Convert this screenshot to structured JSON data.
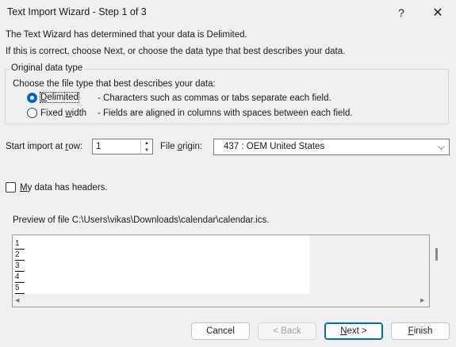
{
  "window": {
    "title": "Text Import Wizard - Step 1 of 3",
    "help_icon": "question-mark-icon",
    "close_icon": "close-icon"
  },
  "intro": {
    "line1": "The Text Wizard has determined that your data is Delimited.",
    "line2": "If this is correct, choose Next, or choose the data type that best describes your data."
  },
  "original_data_type": {
    "legend": "Original data type",
    "prompt": "Choose the file type that best describes your data:",
    "options": [
      {
        "label_underlined": "D",
        "label_rest": "elimited",
        "description": "- Characters such as commas or tabs separate each field.",
        "selected": true
      },
      {
        "label_start": "Fixed ",
        "label_underlined": "w",
        "label_rest": "idth",
        "description": "- Fields are aligned in columns with spaces between each field.",
        "selected": false
      }
    ]
  },
  "start_import": {
    "label_start": "Start import at ",
    "label_underlined": "r",
    "label_rest": "ow:",
    "value": "1"
  },
  "file_origin": {
    "label_start": "File ",
    "label_underlined": "o",
    "label_rest": "rigin:",
    "value": "437 : OEM United States"
  },
  "headers": {
    "label_underlined": "M",
    "label_rest": "y data has headers.",
    "checked": false
  },
  "preview": {
    "label": "Preview of file C:\\Users\\vikas\\Downloads\\calendar\\calendar.ics.",
    "row_numbers": [
      "1",
      "2",
      "3",
      "4",
      "5"
    ]
  },
  "buttons": {
    "cancel": "Cancel",
    "back": "< Back",
    "next_underlined": "N",
    "next_rest": "ext >",
    "finish_underlined": "F",
    "finish_rest": "inish"
  },
  "colors": {
    "accent": "#0067c0",
    "background": "#f0f0f0"
  }
}
